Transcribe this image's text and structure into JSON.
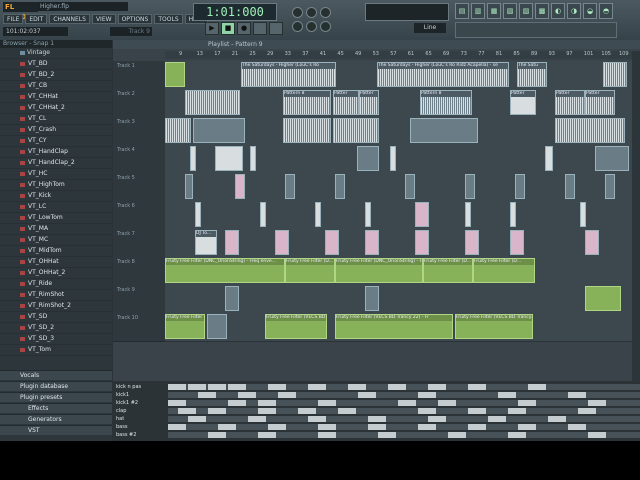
{
  "app": {
    "logo": "FL STUDIO",
    "file": "Higher.flp"
  },
  "menu": [
    "FILE",
    "EDIT",
    "CHANNELS",
    "VIEW",
    "OPTIONS",
    "TOOLS",
    "HELP"
  ],
  "hint": "101:02:037",
  "hint_right": "Track 9",
  "transport": {
    "time": "1:01:000",
    "line": "Line"
  },
  "browser": {
    "header": "Browser - Snap 1",
    "folder": "Vintage",
    "items": [
      "VT_BD",
      "VT_BD_2",
      "VT_CB",
      "VT_CHHat",
      "VT_CHHat_2",
      "VT_CL",
      "VT_Crash",
      "VT_CY",
      "VT_HandClap",
      "VT_HandClap_2",
      "VT_HC",
      "VT_HighTom",
      "VT_Kick",
      "VT_LC",
      "VT_LowTom",
      "VT_MA",
      "VT_MC",
      "VT_MidTom",
      "VT_OHHat",
      "VT_OHHat_2",
      "VT_Ride",
      "VT_RimShot",
      "VT_RimShot_2",
      "VT_SD",
      "VT_SD_2",
      "VT_SD_3",
      "VT_Tom"
    ],
    "bottom": [
      "Vocals",
      "Plugin database",
      "Plugin presets",
      "Effects",
      "Generators",
      "VST"
    ]
  },
  "playlist": {
    "title": "Playlist - Pattern 9",
    "ruler": [
      "9",
      "13",
      "17",
      "21",
      "25",
      "29",
      "33",
      "37",
      "41",
      "45",
      "49",
      "53",
      "57",
      "61",
      "65",
      "69",
      "73",
      "77",
      "81",
      "85",
      "89",
      "93",
      "97",
      "101",
      "105",
      "109",
      "113"
    ],
    "tracks": [
      "Track 1",
      "Track 2",
      "Track 3",
      "Track 4",
      "Track 5",
      "Track 6",
      "Track 7",
      "Track 8",
      "Track 9",
      "Track 10"
    ],
    "clip_text": {
      "t1a": "The Saturdays - Higher (LouC's Ro",
      "t1b": "The Saturdays - Higher (LouC's Ro Ridz Acapella) - se",
      "t1c": "The Satu",
      "pattern": "Patter",
      "pattern8": "Pattern 8",
      "t7": "DJ To...",
      "t8": "Fruity Free Filter (DNC_OrionString) - Freq enve...",
      "t8b": "Fruity Free Filter (DNC_OrionString) - Freq",
      "t8c": "Fruity Free Filter (D...",
      "t10": "Fruity Free Filter (VECS BD Trancy...",
      "t10b": "Fruity Free Filter (VECS BD Trancy 22) - Fr"
    }
  },
  "pianoroll": {
    "rows": [
      "kick n pas",
      "kick1",
      "kick1 #2",
      "clap",
      "hat",
      "bass",
      "bass #2"
    ]
  }
}
